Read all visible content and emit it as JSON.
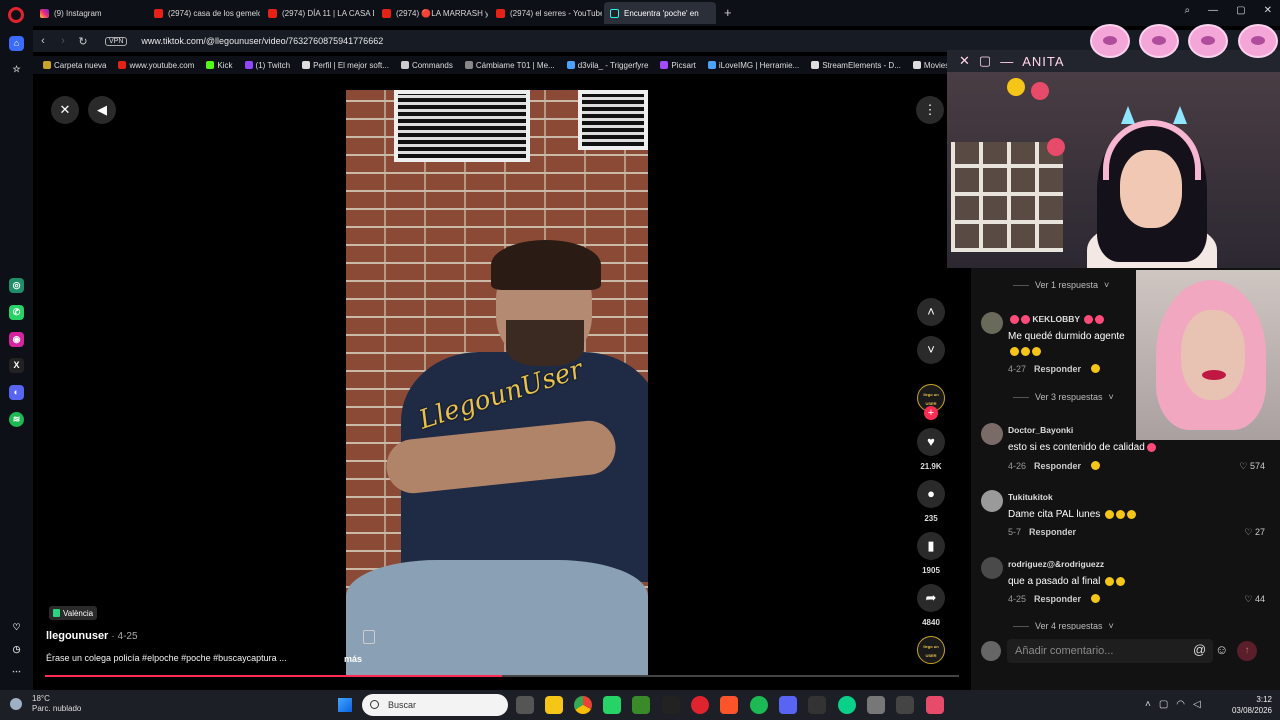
{
  "browser": {
    "tabs": [
      {
        "label": "(9) Instagram",
        "icon": "instagram-icon"
      },
      {
        "label": "(2974) casa de los gemelos",
        "icon": "youtube-icon"
      },
      {
        "label": "(2974) DÍA 11 | LA CASA D",
        "icon": "youtube-icon"
      },
      {
        "label": "(2974) 🔴LA MARRASH y",
        "icon": "youtube-icon"
      },
      {
        "label": "(2974) el serres - YouTube",
        "icon": "youtube-icon"
      },
      {
        "label": "Encuentra 'poche' en",
        "icon": "tiktok-icon"
      }
    ],
    "new_tab": "+",
    "url": "www.tiktok.com/@llegounuser/video/7632760875941776662",
    "vpn": "VPN",
    "bookmarks": [
      "Carpeta nueva",
      "www.youtube.com",
      "Kick",
      "(1) Twitch",
      "Perfil | El mejor soft...",
      "Commands",
      "Cámbiame T01 | Me...",
      "d3vila_ - Triggerfyre",
      "Picsart",
      "iLoveIMG | Herramie...",
      "StreamElements - D...",
      "Movies / TV"
    ]
  },
  "video": {
    "location": "València",
    "author": "llegounuser",
    "date": "· 4-25",
    "caption": "Érase un colega policía  #elpoche #poche #buscaycaptura ...",
    "more": "más",
    "watermark": "LlegounUser",
    "progress": 0.5,
    "actions": {
      "likes": "21.9K",
      "comments": "235",
      "saves": "1905",
      "shares": "4840"
    },
    "creator_badge": "llego un USER"
  },
  "comments": {
    "top_replies": "Ver 1 respuesta",
    "items": [
      {
        "user": "KEKLOBBY",
        "text": "Me quedé durmido agente",
        "date": "4-27",
        "reply": "Responder",
        "likes": ""
      },
      {
        "user": "Doctor_Bayonki",
        "text": "esto si es contenido de calidad",
        "date": "4-26",
        "reply": "Responder",
        "likes": "574"
      },
      {
        "user": "Tukitukitok",
        "text": "Dame cita PAL lunes",
        "date": "5-7",
        "reply": "Responder",
        "likes": "27"
      },
      {
        "user": "rodriguez@&rodriguezz",
        "text": "que a pasado al final",
        "date": "4-25",
        "reply": "Responder",
        "likes": "44"
      }
    ],
    "mid_replies": "Ver 3 respuestas",
    "bottom_replies": "Ver 4 respuestas",
    "input_placeholder": "Añadir comentario..."
  },
  "overlay": {
    "streamer_name": "ANITA"
  },
  "taskbar": {
    "temperature": "18°C",
    "weather": "Parc. nublado",
    "search_placeholder": "Buscar",
    "time": "3:12",
    "date": "03/08/2026"
  }
}
